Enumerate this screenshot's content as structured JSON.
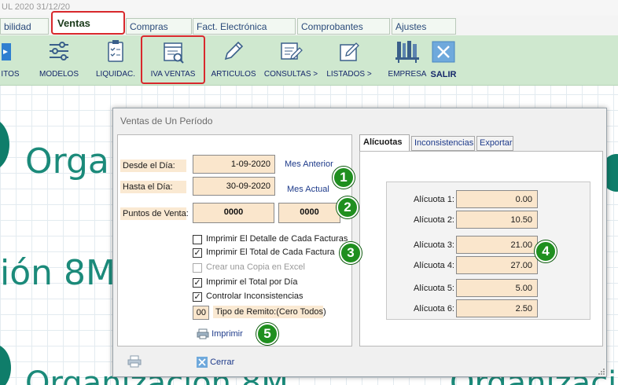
{
  "window": {
    "title_fragment": "UL 2020 31/12/20"
  },
  "tabs": [
    {
      "label": "bilidad"
    },
    {
      "label": "Ventas"
    },
    {
      "label": "Compras"
    },
    {
      "label": "Fact. Electrónica"
    },
    {
      "label": "Comprobantes"
    },
    {
      "label": "Ajustes"
    }
  ],
  "toolbar": [
    {
      "label": "ITOS",
      "icon": "partial-icon"
    },
    {
      "label": "MODELOS",
      "icon": "sliders-icon"
    },
    {
      "label": "LIQUIDAC.",
      "icon": "clipboard-icon"
    },
    {
      "label": "IVA VENTAS",
      "icon": "document-search-icon"
    },
    {
      "label": "ARTICULOS",
      "icon": "pencil-icon"
    },
    {
      "label": "CONSULTAS >",
      "icon": "form-pencil-icon"
    },
    {
      "label": "LISTADOS >",
      "icon": "edit-note-icon"
    },
    {
      "label": "EMPRESA",
      "icon": "bookshelf-icon"
    },
    {
      "label": "SALIR",
      "icon": "close-x-icon"
    }
  ],
  "background": {
    "lines": [
      "Orga",
      "ión 8M",
      "Organización 8M",
      "Organizaci"
    ]
  },
  "dialog": {
    "title": "Ventas de Un Período",
    "desde_label": "Desde el Día:",
    "desde_value": "1-09-2020",
    "mes_anterior": "Mes Anterior",
    "hasta_label": "Hasta el Día:",
    "hasta_value": "30-09-2020",
    "mes_actual": "Mes Actual",
    "puntos_label": "Puntos de Venta:",
    "punto_desde": "0000",
    "punto_hasta": "0000",
    "options": [
      {
        "label": "Imprimir El Detalle de Cada Facturas",
        "checked": false,
        "disabled": false
      },
      {
        "label": "Imprimir El Total de Cada Factura",
        "checked": true,
        "disabled": false
      },
      {
        "label": "Crear una Copia en Excel",
        "checked": false,
        "disabled": true
      },
      {
        "label": "Imprimir el Total por Día",
        "checked": true,
        "disabled": false
      },
      {
        "label": "Controlar Inconsistencias",
        "checked": true,
        "disabled": false
      }
    ],
    "remito_value": "00",
    "remito_label": "Tipo de Remito:(Cero Todos)",
    "imprimir": "Imprimir",
    "cerrar": "Cerrar",
    "tabs": [
      "Alícuotas",
      "Inconsistencias",
      "Exportar"
    ],
    "alicuotas": [
      {
        "label": "Alícuota 1:",
        "value": "0.00"
      },
      {
        "label": "Alícuota 2:",
        "value": "10.50"
      },
      {
        "label": "Alícuota 3:",
        "value": "21.00"
      },
      {
        "label": "Alícuota 4:",
        "value": "27.00"
      },
      {
        "label": "Alícuota 5:",
        "value": "5.00"
      },
      {
        "label": "Alícuota 6:",
        "value": "2.50"
      }
    ]
  },
  "badges": [
    "1",
    "2",
    "3",
    "4",
    "5"
  ],
  "colors": {
    "toolbar_bg": "#cfe8cf",
    "highlight": "#d8282c",
    "badge": "#1f8f1f",
    "field_bg": "#fae6cc"
  }
}
